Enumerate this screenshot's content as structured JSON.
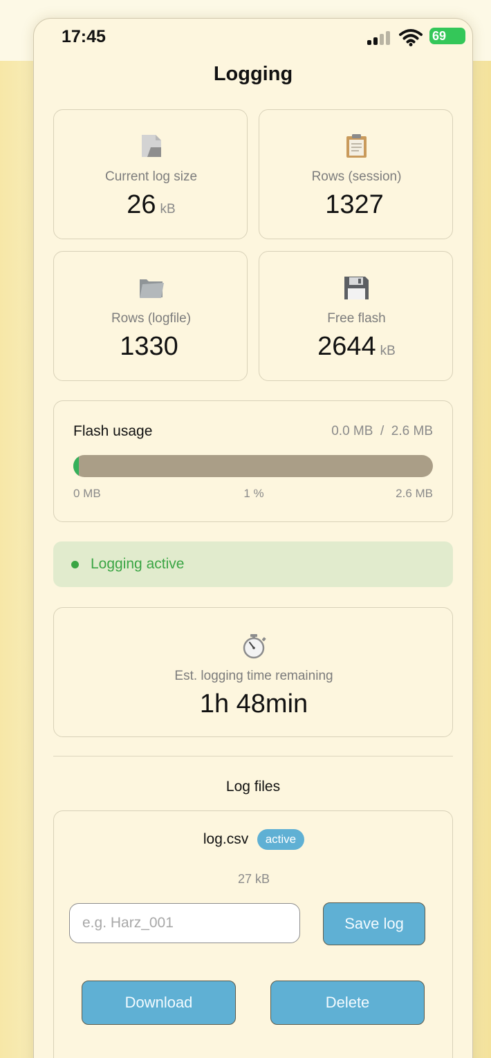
{
  "status_bar": {
    "time": "17:45",
    "battery": "69"
  },
  "page": {
    "title": "Logging"
  },
  "stats": [
    {
      "label": "Current log size",
      "value": "26",
      "unit": "kB",
      "icon": "document-icon"
    },
    {
      "label": "Rows (session)",
      "value": "1327",
      "unit": "",
      "icon": "clipboard-icon"
    },
    {
      "label": "Rows (logfile)",
      "value": "1330",
      "unit": "",
      "icon": "folder-icon"
    },
    {
      "label": "Free flash",
      "value": "2644",
      "unit": "kB",
      "icon": "floppy-disk-icon"
    }
  ],
  "flash_usage": {
    "title": "Flash usage",
    "summary": "0.0 MB  /  2.6 MB",
    "min_label": "0 MB",
    "percent_label": "1 %",
    "max_label": "2.6 MB",
    "percent": 1,
    "fill_color": "#35b15a",
    "track_color": "#aa9e87"
  },
  "logging_status": {
    "text": "Logging active",
    "color": "#3aa544"
  },
  "time_remaining": {
    "label": "Est. logging time remaining",
    "value": "1h 48min",
    "icon": "stopwatch-icon"
  },
  "log_files": {
    "title": "Log files",
    "file": {
      "name": "log.csv",
      "badge": "active",
      "size": "27 kB"
    },
    "name_input": {
      "placeholder": "e.g. Harz_001",
      "value": ""
    },
    "save_label": "Save log",
    "download_label": "Download",
    "delete_label": "Delete"
  },
  "colors": {
    "accent_button": "#5fb0d4",
    "background": "#fdf6de",
    "battery": "#34c759"
  }
}
